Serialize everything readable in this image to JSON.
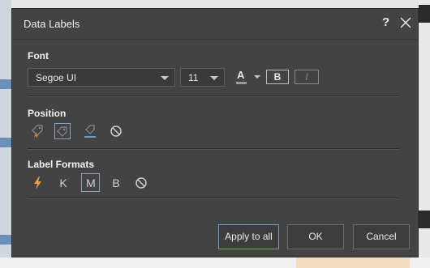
{
  "dialog": {
    "title": "Data Labels",
    "help": "?"
  },
  "font": {
    "section": "Font",
    "family": "Segoe UI",
    "size": "11",
    "color_glyph": "A",
    "bold": "B",
    "italic": "I"
  },
  "position": {
    "section": "Position",
    "options": [
      "label-inside-icon",
      "label-outside-icon",
      "label-above-icon",
      "none-icon"
    ],
    "selected": "label-outside-icon"
  },
  "label_formats": {
    "section": "Label Formats",
    "k": "K",
    "m": "M",
    "b": "B",
    "selected": "M"
  },
  "buttons": {
    "apply_all": "Apply to all",
    "ok": "OK",
    "cancel": "Cancel"
  },
  "colors": {
    "dialog_bg": "#434343",
    "accent_border": "#7fa6c9",
    "bolt": "#e8a33c"
  }
}
